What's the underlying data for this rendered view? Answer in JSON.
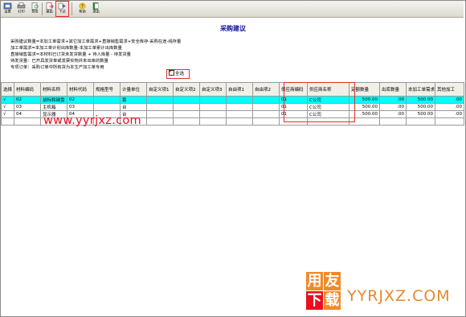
{
  "toolbar": {
    "buttons": [
      {
        "label": "设置",
        "icon": "settings-icon"
      },
      {
        "label": "打印",
        "icon": "print-icon"
      },
      {
        "label": "预览",
        "icon": "preview-icon"
      },
      {
        "label": "输出",
        "icon": "export-icon"
      },
      {
        "label": "下达",
        "icon": "issue-icon"
      },
      {
        "label": "帮助",
        "icon": "help-icon"
      },
      {
        "label": "退出",
        "icon": "exit-icon"
      }
    ]
  },
  "page": {
    "title": "采购建议",
    "desc_lines": [
      "采购建议数量=本加工单需求+其它加工单需求+直接销售需求+安全库存-采购在途-线存量",
      "加工单需求=本加工单计划出库数量-本加工单累计出库数量",
      "直接销售需求=本材料已订货未发货数量 + 待入库量 - 待发货量",
      "待发货量：已开具发货单或发票实物并未出库的数量",
      "专项订单：采购订单中所有货为本生产加工单专用"
    ],
    "select_all_label": "全选"
  },
  "grid": {
    "columns": [
      "选择",
      "材料编码",
      "材料名称",
      "材料代码",
      "规格型号",
      "计量单位",
      "自定义项1",
      "自定义项2",
      "自定义项3",
      "自由项1",
      "自由项2",
      "供应商编码",
      "供应商名称",
      "定额数量",
      "出库数量",
      "本加工单需求",
      "其他加工"
    ],
    "rows": [
      {
        "check": "√",
        "code": "02",
        "name": "鼠标和键盘",
        "alias": "02",
        "spec": "",
        "unit": "套",
        "vcode": "01",
        "vname": "C公司",
        "qty": "500.00",
        "out": ".00",
        "need": "500.00",
        "other": ".00"
      },
      {
        "check": "√",
        "code": "03",
        "name": "主机箱",
        "alias": "03",
        "spec": "",
        "unit": "台",
        "vcode": "01",
        "vname": "C公司",
        "qty": "500.00",
        "out": ".00",
        "need": "500.00",
        "other": ".00"
      },
      {
        "check": "√",
        "code": "04",
        "name": "显示器",
        "alias": "04",
        "spec": "",
        "unit": "台",
        "vcode": "01",
        "vname": "C公司",
        "qty": "500.00",
        "out": ".00",
        "need": "500.00",
        "other": ".00"
      }
    ]
  },
  "watermark": {
    "url": "www.yyrjxz.com",
    "logo_chars": [
      "用",
      "友",
      "下",
      "载"
    ],
    "site": "YYRJXZ.COM",
    "colors": {
      "red": "#e81020",
      "orange": "#f08a2a"
    }
  },
  "colors": {
    "selected_row": "#00ffff",
    "highlight": "#e0302a",
    "title": "#1010a0"
  }
}
